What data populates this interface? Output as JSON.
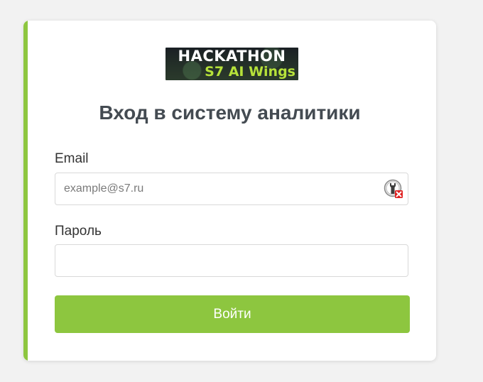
{
  "logo": {
    "line1": "HACKATHON",
    "line2": "S7 AI Wings"
  },
  "form": {
    "title": "Вход в систему аналитики",
    "email_label": "Email",
    "email_placeholder": "example@s7.ru",
    "email_value": "",
    "password_label": "Пароль",
    "password_value": "",
    "submit_label": "Войти"
  },
  "icons": {
    "password_manager": "password-manager-icon"
  },
  "colors": {
    "accent": "#8dc63f",
    "title": "#444b52",
    "background": "#f2f2f2"
  }
}
